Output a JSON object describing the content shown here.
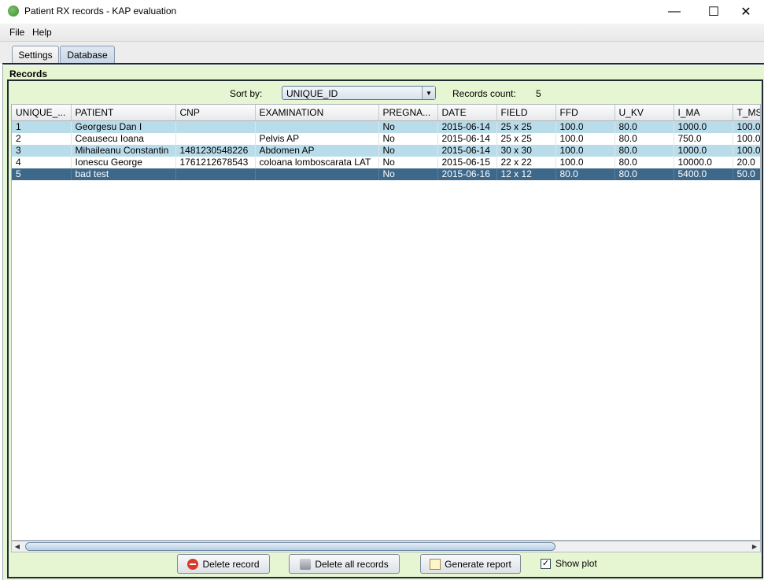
{
  "window": {
    "title": "Patient RX records - KAP evaluation",
    "minimize_glyph": "—",
    "maximize_glyph": "☐",
    "close_glyph": "✕"
  },
  "menu": {
    "file": "File",
    "help": "Help"
  },
  "tabs": [
    {
      "label": "Settings",
      "active": false
    },
    {
      "label": "Database",
      "active": true
    }
  ],
  "panel": {
    "title": "Records",
    "sort_label": "Sort by:",
    "sort_value": "UNIQUE_ID",
    "count_label": "Records count:",
    "count_value": "5"
  },
  "table": {
    "columns": [
      "UNIQUE_...",
      "PATIENT",
      "CNP",
      "EXAMINATION",
      "PREGNA...",
      "DATE",
      "FIELD",
      "FFD",
      "U_KV",
      "I_MA",
      "T_MS"
    ],
    "rows": [
      [
        "1",
        "Georgesu Dan I",
        "",
        "",
        "No",
        "2015-06-14",
        "25 x 25",
        "100.0",
        "80.0",
        "1000.0",
        "100.0"
      ],
      [
        "2",
        "Ceausecu Ioana",
        "",
        "Pelvis AP",
        "No",
        "2015-06-14",
        "25 x 25",
        "100.0",
        "80.0",
        "750.0",
        "100.0"
      ],
      [
        "3",
        "Mihaileanu Constantin",
        "1481230548226",
        "Abdomen AP",
        "No",
        "2015-06-14",
        "30 x 30",
        "100.0",
        "80.0",
        "1000.0",
        "100.0"
      ],
      [
        "4",
        "Ionescu George",
        "1761212678543",
        "coloana lomboscarata LAT",
        "No",
        "2015-06-15",
        "22 x 22",
        "100.0",
        "80.0",
        "10000.0",
        "20.0"
      ],
      [
        "5",
        "bad test",
        "",
        "",
        "No",
        "2015-06-16",
        "12 x 12",
        "80.0",
        "80.0",
        "5400.0",
        "50.0"
      ]
    ],
    "selected_row_index": 4
  },
  "buttons": {
    "delete_record": "Delete record",
    "delete_all": "Delete all records",
    "generate_report": "Generate report"
  },
  "show_plot": {
    "label": "Show plot",
    "checked": true,
    "check_glyph": "✓"
  },
  "colors": {
    "panel_bg": "#e6f5d2",
    "row_highlight": "#b9dcea",
    "row_selected": "#3d6889"
  }
}
